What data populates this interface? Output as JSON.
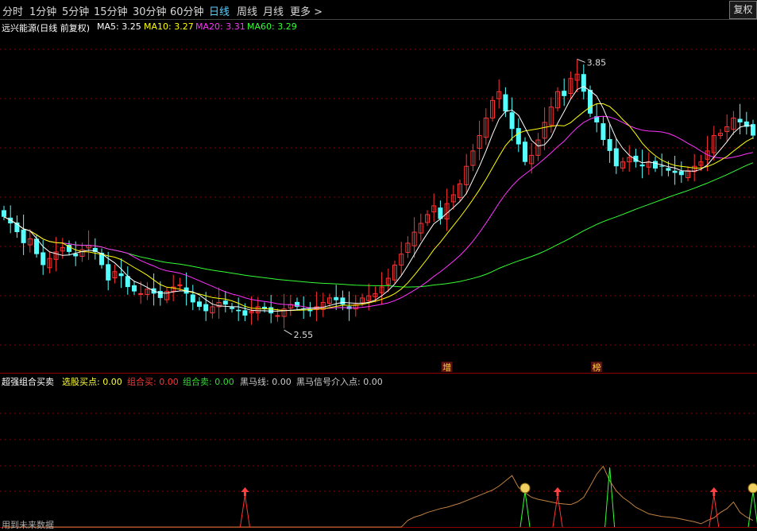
{
  "toolbar": {
    "periods": [
      {
        "label": "分时",
        "active": false
      },
      {
        "label": "1分钟",
        "active": false
      },
      {
        "label": "5分钟",
        "active": false
      },
      {
        "label": "15分钟",
        "active": false
      },
      {
        "label": "30分钟",
        "active": false
      },
      {
        "label": "60分钟",
        "active": false
      },
      {
        "label": "日线",
        "active": true
      },
      {
        "label": "周线",
        "active": false
      },
      {
        "label": "月线",
        "active": false
      },
      {
        "label": "更多 >",
        "active": false
      }
    ],
    "restore_label": "复权"
  },
  "main_info": {
    "title": "远兴能源(日线 前复权)",
    "ma": [
      {
        "label": "MA5: 3.25",
        "color": "#ffffff"
      },
      {
        "label": "MA10: 3.27",
        "color": "#ffff00"
      },
      {
        "label": "MA20: 3.31",
        "color": "#ff33ff"
      },
      {
        "label": "MA60: 3.29",
        "color": "#33ff33"
      }
    ]
  },
  "indicator_info": {
    "title": "超强组合买卖",
    "items": [
      {
        "label": "选股买点: 0.00",
        "color": "#ffff33"
      },
      {
        "label": "组合买: 0.00",
        "color": "#ff3333"
      },
      {
        "label": "组合卖: 0.00",
        "color": "#33dd33"
      },
      {
        "label": "黑马线: 0.00",
        "color": "#cccccc"
      },
      {
        "label": "黑马信号介入点: 0.00",
        "color": "#cccccc"
      }
    ]
  },
  "footer_text": "用到未来数据",
  "colors": {
    "up": "#ff3232",
    "down": "#54ffff",
    "ma5": "#ffffff",
    "ma10": "#ffff00",
    "ma20": "#ff33ff",
    "ma60": "#33ff33",
    "grid": "#8b0000",
    "blackhorse": "#c08040"
  },
  "chart_data": [
    {
      "type": "candlestick",
      "title": "远兴能源(日线 前复权)",
      "ylim": [
        2.45,
        4.0
      ],
      "max_label": "3.85",
      "min_label": "2.55",
      "markers": [
        "增",
        "榜"
      ],
      "closes": [
        3.15,
        3.12,
        3.08,
        3.03,
        3.05,
        2.98,
        2.93,
        2.96,
        2.99,
        3.01,
        2.99,
        2.97,
        3.0,
        3.02,
        2.99,
        2.93,
        2.86,
        2.9,
        2.88,
        2.83,
        2.81,
        2.8,
        2.82,
        2.8,
        2.78,
        2.81,
        2.83,
        2.84,
        2.8,
        2.76,
        2.74,
        2.72,
        2.74,
        2.76,
        2.75,
        2.73,
        2.72,
        2.7,
        2.72,
        2.74,
        2.73,
        2.71,
        2.7,
        2.73,
        2.75,
        2.74,
        2.73,
        2.72,
        2.74,
        2.76,
        2.78,
        2.77,
        2.75,
        2.73,
        2.75,
        2.78,
        2.79,
        2.8,
        2.83,
        2.87,
        2.93,
        2.98,
        3.03,
        3.08,
        3.12,
        3.16,
        3.2,
        3.14,
        3.21,
        3.25,
        3.3,
        3.38,
        3.45,
        3.52,
        3.6,
        3.68,
        3.72,
        3.63,
        3.55,
        3.48,
        3.4,
        3.43,
        3.5,
        3.58,
        3.65,
        3.72,
        3.7,
        3.78,
        3.8,
        3.72,
        3.62,
        3.58,
        3.5,
        3.45,
        3.38,
        3.4,
        3.42,
        3.4,
        3.38,
        3.4,
        3.37,
        3.38,
        3.36,
        3.35,
        3.34,
        3.36,
        3.38,
        3.4,
        3.45,
        3.52,
        3.53,
        3.56,
        3.6,
        3.58,
        3.56,
        3.52
      ],
      "ma_lines": [
        "MA5",
        "MA10",
        "MA20",
        "MA60"
      ]
    },
    {
      "type": "line",
      "title": "超强组合买卖",
      "series": [
        {
          "name": "黑马线",
          "values": [
            0,
            0,
            0,
            0,
            0,
            0,
            0,
            0,
            0,
            0,
            0,
            0,
            0,
            0,
            0,
            0,
            0,
            0,
            0,
            0,
            0,
            0,
            0,
            0,
            0,
            0,
            0,
            0,
            0,
            0,
            0,
            0,
            0,
            0,
            0,
            0,
            0,
            0,
            0,
            0,
            0,
            0,
            0,
            0,
            0,
            0,
            0,
            0,
            0,
            0,
            0,
            0,
            0,
            0,
            0,
            0,
            0,
            0,
            0,
            0,
            0,
            0,
            0.1,
            0.15,
            0.18,
            0.22,
            0.25,
            0.28,
            0.3,
            0.33,
            0.36,
            0.4,
            0.44,
            0.48,
            0.52,
            0.56,
            0.62,
            0.7,
            0.78,
            0.6,
            0.52,
            0.45,
            0.42,
            0.4,
            0.38,
            0.36,
            0.35,
            0.34,
            0.38,
            0.45,
            0.62,
            0.8,
            0.92,
            0.7,
            0.55,
            0.45,
            0.38,
            0.3,
            0.25,
            0.2,
            0.18,
            0.16,
            0.15,
            0.14,
            0.12,
            0.1,
            0.08,
            0.05,
            0.1,
            0.14,
            0.22,
            0.28,
            0.38,
            0.22,
            0.15,
            0.1
          ]
        }
      ],
      "buy_signals_count": 5
    }
  ]
}
